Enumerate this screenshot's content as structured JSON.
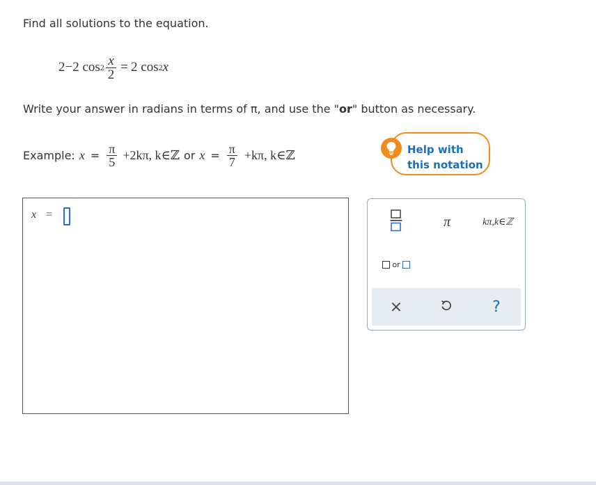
{
  "question": {
    "instruction": "Find all solutions to the equation.",
    "equation": {
      "lhs_prefix": "2−2 cos",
      "lhs_power": "2",
      "frac_num": "x",
      "frac_den": "2",
      "equals": "=",
      "rhs_coef": "2 cos",
      "rhs_power": "2",
      "rhs_var": "x"
    },
    "write_prefix": "Write your answer in radians in terms of π, and use the \"",
    "write_bold": "or",
    "write_suffix": "\" button as necessary."
  },
  "example": {
    "label": "Example:",
    "var1": "x",
    "eq1": "=",
    "num1": "π",
    "den1": "5",
    "term1": "+2kπ, k∈ℤ",
    "or_text": "or",
    "var2": "x",
    "eq2": "=",
    "num2": "π",
    "den2": "7",
    "term2": "+kπ, k∈ℤ"
  },
  "help": {
    "line1": "Help with",
    "line2": "this notation",
    "icon": "lightbulb-icon"
  },
  "answer": {
    "var": "x",
    "equals": "=",
    "value": ""
  },
  "palette": {
    "fraction": "fraction-icon",
    "pi": "π",
    "kpi": "kπ,k∈ℤ",
    "or_label": "or",
    "clear": "×",
    "undo": "undo-icon",
    "help": "?"
  },
  "colors": {
    "accent_orange": "#f08c1e",
    "link_blue": "#1a6fb5",
    "cursor_blue": "#2b6fd6",
    "tray_gray": "#e6ecf0"
  }
}
